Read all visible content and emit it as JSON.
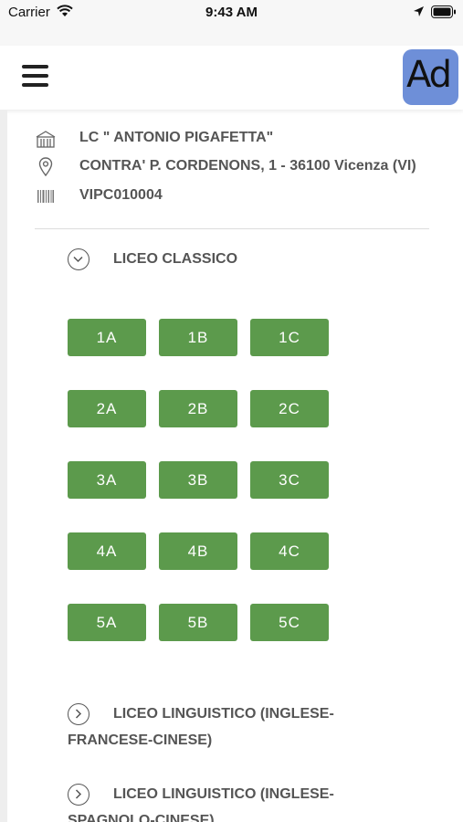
{
  "status_bar": {
    "carrier": "Carrier",
    "time": "9:43 AM"
  },
  "header": {
    "logo_text": "Ad"
  },
  "school": {
    "name": "LC \" ANTONIO PIGAFETTA\"",
    "address": "CONTRA' P. CORDENONS, 1 - 36100 Vicenza (VI)",
    "code": "VIPC010004"
  },
  "sections": [
    {
      "title": "LICEO CLASSICO",
      "expanded": true,
      "classes": [
        [
          "1A",
          "1B",
          "1C"
        ],
        [
          "2A",
          "2B",
          "2C"
        ],
        [
          "3A",
          "3B",
          "3C"
        ],
        [
          "4A",
          "4B",
          "4C"
        ],
        [
          "5A",
          "5B",
          "5C"
        ]
      ]
    },
    {
      "title_line1": "LICEO LINGUISTICO (INGLESE-",
      "title_line2": "FRANCESE-CINESE)",
      "expanded": false
    },
    {
      "title_line1": "LICEO LINGUISTICO (INGLESE-",
      "title_line2": "SPAGNOLO-CINESE)",
      "expanded": false
    }
  ],
  "colors": {
    "class_button": "#5c9a4c",
    "text": "#555555"
  }
}
